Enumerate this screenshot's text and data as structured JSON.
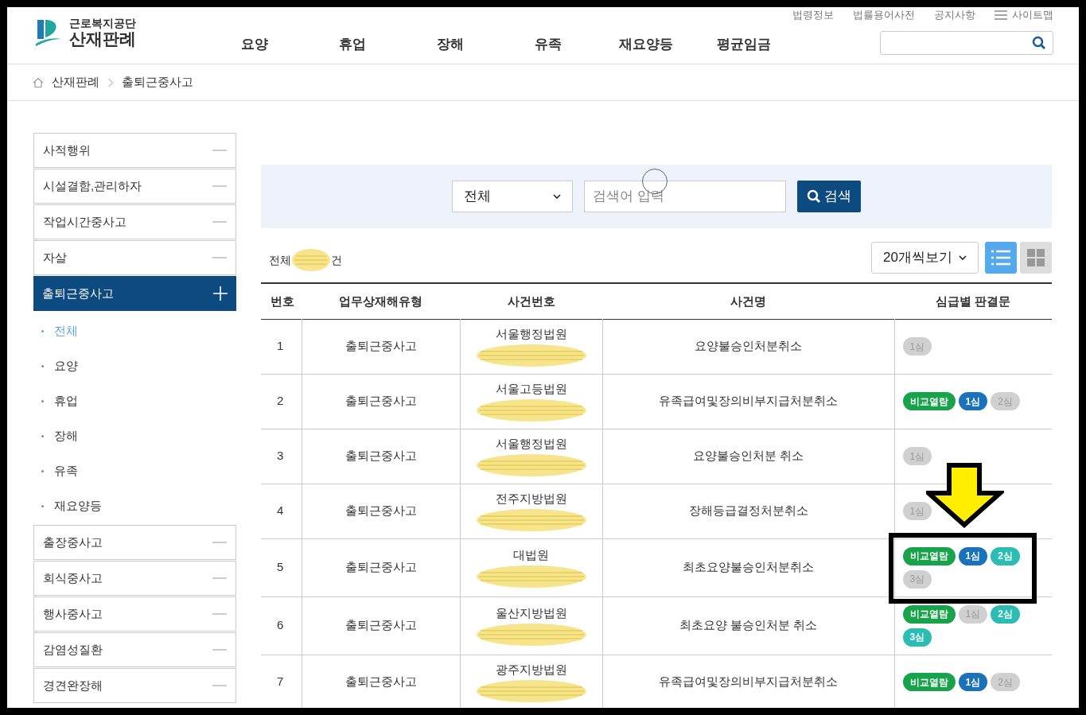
{
  "header": {
    "logo_top": "근로복지공단",
    "logo_main": "산재판례",
    "util_links": [
      "법령정보",
      "법률용어사전",
      "공지사항"
    ],
    "sitemap": "사이트맵",
    "nav": [
      "요양",
      "휴업",
      "장해",
      "유족",
      "재요양등",
      "평균임금"
    ]
  },
  "breadcrumb": [
    "산재판례",
    "출퇴근중사고"
  ],
  "sidebar": [
    {
      "label": "사적행위",
      "expanded": false
    },
    {
      "label": "시설결함,관리하자",
      "expanded": false
    },
    {
      "label": "작업시간중사고",
      "expanded": false
    },
    {
      "label": "자살",
      "expanded": false
    },
    {
      "label": "출퇴근중사고",
      "expanded": true,
      "children": [
        {
          "label": "전체",
          "selected": true
        },
        {
          "label": "요양",
          "selected": false
        },
        {
          "label": "휴업",
          "selected": false
        },
        {
          "label": "장해",
          "selected": false
        },
        {
          "label": "유족",
          "selected": false
        },
        {
          "label": "재요양등",
          "selected": false
        }
      ]
    },
    {
      "label": "출장중사고",
      "expanded": false
    },
    {
      "label": "회식중사고",
      "expanded": false
    },
    {
      "label": "행사중사고",
      "expanded": false
    },
    {
      "label": "감염성질환",
      "expanded": false
    },
    {
      "label": "경견완장해",
      "expanded": false
    }
  ],
  "search": {
    "category": "전체",
    "placeholder": "검색어 입력",
    "button": "검색"
  },
  "summary": {
    "prefix": "전체",
    "suffix": "건",
    "page_size": "20개씩보기",
    "views": [
      {
        "kind": "list",
        "selected": true
      },
      {
        "kind": "grid",
        "selected": false
      }
    ]
  },
  "table": {
    "columns": [
      "번호",
      "업무상재해유형",
      "사건번호",
      "사건명",
      "심급별 판결문"
    ],
    "rows": [
      {
        "no": "1",
        "type": "출퇴근중사고",
        "court": "서울행정법원",
        "title": "요양불승인처분취소",
        "badges": [
          {
            "label": "1심",
            "color": "#d0d0d0",
            "active": false
          }
        ]
      },
      {
        "no": "2",
        "type": "출퇴근중사고",
        "court": "서울고등법원",
        "title": "유족급여및장의비부지급처분취소",
        "badges": [
          {
            "label": "비교열람",
            "color": "#16a34a",
            "active": true
          },
          {
            "label": "1심",
            "color": "#1a72bb",
            "active": true
          },
          {
            "label": "2심",
            "color": "#d0d0d0",
            "active": false
          }
        ]
      },
      {
        "no": "3",
        "type": "출퇴근중사고",
        "court": "서울행정법원",
        "title": "요양불승인처분 취소",
        "badges": [
          {
            "label": "1심",
            "color": "#d0d0d0",
            "active": false
          }
        ]
      },
      {
        "no": "4",
        "type": "출퇴근중사고",
        "court": "전주지방법원",
        "title": "장해등급결정처분취소",
        "badges": [
          {
            "label": "1심",
            "color": "#d0d0d0",
            "active": false
          }
        ]
      },
      {
        "no": "5",
        "type": "출퇴근중사고",
        "court": "대법원",
        "title": "최초요양불승인처분취소",
        "badges": [
          {
            "label": "비교열람",
            "color": "#16a34a",
            "active": true
          },
          {
            "label": "1심",
            "color": "#1a72bb",
            "active": true
          },
          {
            "label": "2심",
            "color": "#2bbdb3",
            "active": true
          },
          {
            "label": "3심",
            "color": "#d0d0d0",
            "active": false
          }
        ]
      },
      {
        "no": "6",
        "type": "출퇴근중사고",
        "court": "울산지방법원",
        "title": "최초요양 불승인처분 취소",
        "badges": [
          {
            "label": "비교열람",
            "color": "#16a34a",
            "active": true
          },
          {
            "label": "1심",
            "color": "#d0d0d0",
            "active": false
          },
          {
            "label": "2심",
            "color": "#2bbdb3",
            "active": true
          },
          {
            "label": "3심",
            "color": "#2bbdb3",
            "active": true
          }
        ]
      },
      {
        "no": "7",
        "type": "출퇴근중사고",
        "court": "광주지방법원",
        "title": "유족급여및장의비부지급처분취소",
        "badges": [
          {
            "label": "비교열람",
            "color": "#16a34a",
            "active": true
          },
          {
            "label": "1심",
            "color": "#1a72bb",
            "active": true
          },
          {
            "label": "2심",
            "color": "#d0d0d0",
            "active": false
          }
        ]
      }
    ]
  }
}
